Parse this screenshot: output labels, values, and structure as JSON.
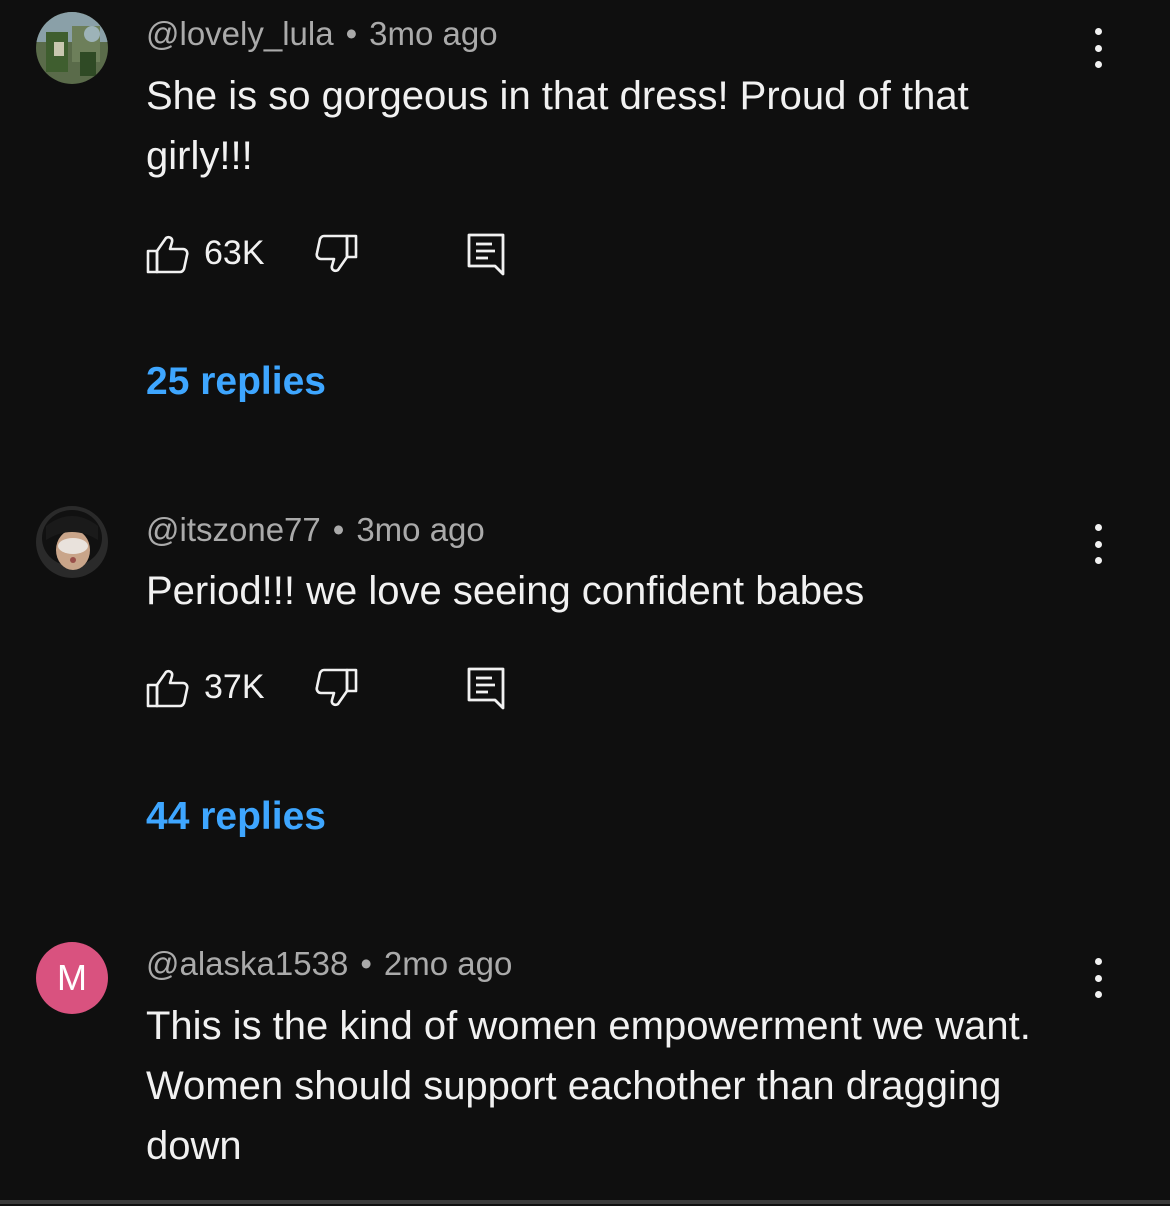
{
  "comments": [
    {
      "author": "@lovely_lula",
      "time": "3mo ago",
      "text": "She is so gorgeous in that dress! Proud of that girly!!!",
      "likes": "63K",
      "replies": "25 replies",
      "avatar": "photo"
    },
    {
      "author": "@itszone77",
      "time": "3mo ago",
      "text": "Period!!! we love seeing confident babes",
      "likes": "37K",
      "replies": "44 replies",
      "avatar": "photo"
    },
    {
      "author": "@alaska1538",
      "time": "2mo ago",
      "text": "This is the kind of women empowerment we want. Women should support eachother than dragging down",
      "avatar_letter": "M",
      "avatar_color": "#d9527f"
    }
  ],
  "separator": "•",
  "colors": {
    "background": "#0f0f0f",
    "link": "#3ea6ff",
    "meta": "#aaaaaa"
  },
  "icons": [
    "thumbs-up-icon",
    "thumbs-down-icon",
    "reply-icon",
    "more-vert-icon"
  ]
}
